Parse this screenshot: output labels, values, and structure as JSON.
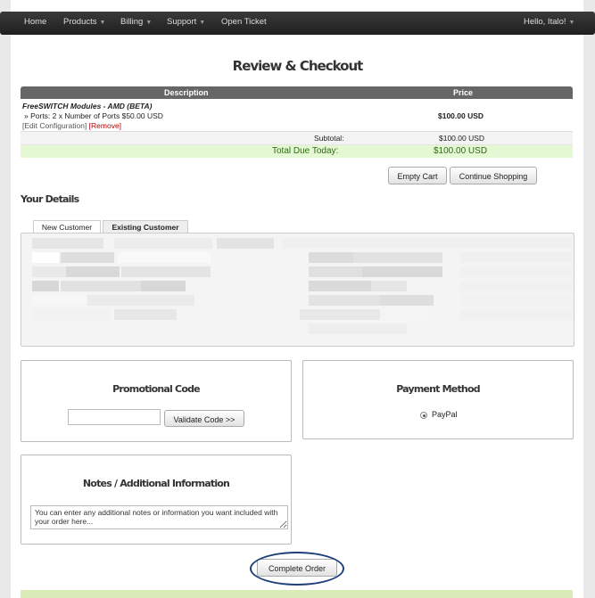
{
  "nav": {
    "home": "Home",
    "products": "Products",
    "billing": "Billing",
    "support": "Support",
    "open_ticket": "Open Ticket",
    "user": "Hello, Italo!"
  },
  "page_title": "Review & Checkout",
  "cart": {
    "headers": {
      "description": "Description",
      "price": "Price"
    },
    "item": {
      "name": "FreeSWITCH Modules - AMD (BETA)",
      "detail": "» Ports: 2 x Number of Ports $50.00 USD",
      "edit_link": "[Edit Configuration]",
      "remove_link": "[Remove]",
      "price": "$100.00 USD"
    },
    "subtotal_label": "Subtotal:",
    "subtotal_value": "$100.00 USD",
    "total_label": "Total Due Today:",
    "total_value": "$100.00 USD"
  },
  "buttons": {
    "empty_cart": "Empty Cart",
    "continue_shopping": "Continue Shopping",
    "validate_code": "Validate Code >>",
    "complete_order": "Complete Order"
  },
  "your_details": {
    "title": "Your Details",
    "tabs": [
      "New Customer",
      "Existing Customer"
    ],
    "active_tab": "Existing Customer"
  },
  "promo": {
    "title": "Promotional Code",
    "value": ""
  },
  "payment": {
    "title": "Payment Method",
    "option": "PayPal",
    "selected": true
  },
  "notes": {
    "title": "Notes / Additional Information",
    "value": "You can enter any additional notes or information you want included with your order here..."
  },
  "colors": {
    "navbar": "#2a2a2a",
    "table_header": "#666666",
    "total_row": "#e4f8d4",
    "total_text": "#2d6a12",
    "remove_link": "#bb0000",
    "highlight_ring": "#1f3f7a"
  }
}
